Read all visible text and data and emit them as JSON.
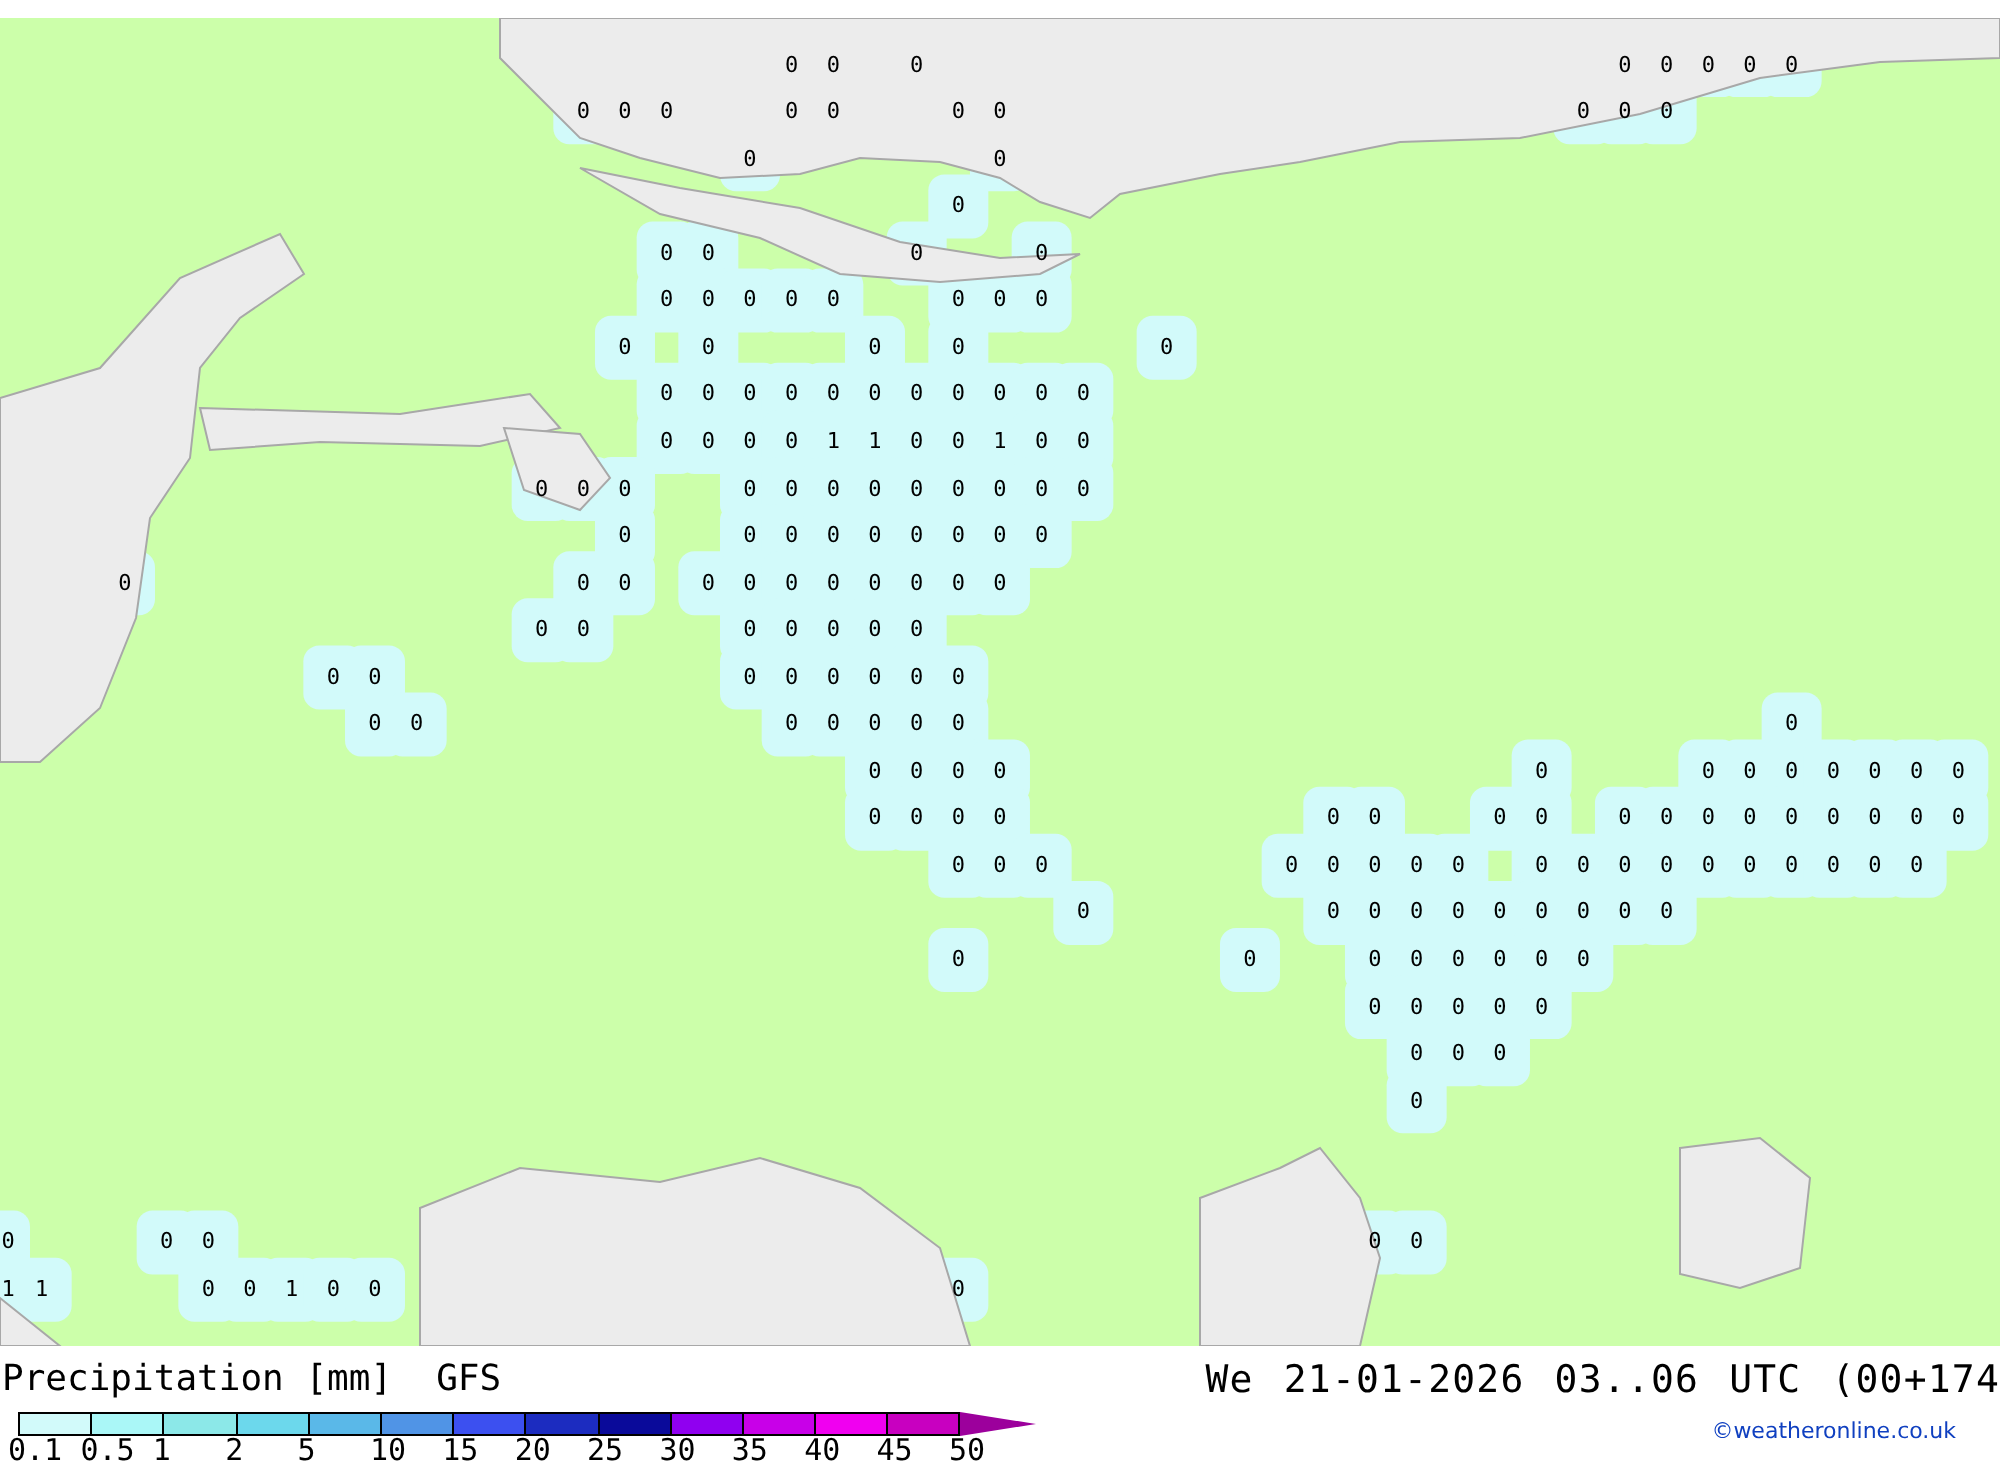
{
  "map": {
    "value_rows": [
      [
        "0",
        "0",
        "0",
        "0",
        "0",
        "0",
        "0",
        "0"
      ],
      [
        "0",
        "0",
        "0",
        "0",
        "0",
        "0",
        "0",
        "0",
        "0",
        "0"
      ],
      [
        "0",
        "0"
      ],
      [
        "0"
      ],
      [
        "0",
        "0",
        "0",
        "0"
      ],
      [
        "0",
        "0",
        "0",
        "0",
        "0",
        "0",
        "0",
        "0"
      ],
      [
        "0",
        "0",
        "0",
        "0",
        "0"
      ],
      [
        "0",
        "0",
        "0",
        "0",
        "0",
        "0",
        "0",
        "0",
        "0",
        "0",
        "0"
      ],
      [
        "0",
        "0",
        "0",
        "0",
        "1",
        "1",
        "0",
        "0",
        "1",
        "0",
        "0"
      ],
      [
        "0",
        "0",
        "0",
        "0",
        "0",
        "0",
        "0",
        "0",
        "0",
        "0",
        "0",
        "0"
      ],
      [
        "0",
        "0",
        "0",
        "0",
        "0",
        "0",
        "0",
        "0",
        "0"
      ],
      [
        "0",
        "0",
        "0",
        "0",
        "0",
        "0",
        "0",
        "0",
        "0",
        "0",
        "0"
      ],
      [
        "0",
        "0",
        "0",
        "0",
        "0",
        "0",
        "0"
      ],
      [
        "0",
        "0",
        "0",
        "0",
        "0",
        "0",
        "0",
        "0"
      ],
      [
        "0",
        "0",
        "0",
        "0",
        "0",
        "0",
        "0",
        "0"
      ],
      [
        "0",
        "0",
        "0",
        "0",
        "0",
        "0",
        "0",
        "0",
        "0",
        "0",
        "0",
        "0"
      ],
      [
        "0",
        "0",
        "0",
        "0",
        "0",
        "0",
        "0",
        "0",
        "0",
        "0",
        "0",
        "0",
        "0",
        "0",
        "0",
        "0",
        "0"
      ],
      [
        "0",
        "0",
        "0",
        "0",
        "0",
        "0",
        "0",
        "0",
        "0",
        "0",
        "0",
        "0",
        "0",
        "0",
        "0",
        "0",
        "0",
        "0"
      ],
      [
        "0",
        "0",
        "0",
        "0",
        "0",
        "0",
        "0",
        "0",
        "0",
        "0"
      ],
      [
        "0",
        "0",
        "0",
        "0",
        "0",
        "0",
        "0",
        "0"
      ],
      [
        "0",
        "0",
        "0",
        "0",
        "0"
      ],
      [
        "0",
        "0",
        "0"
      ],
      [
        "0"
      ],
      [
        "0",
        "0",
        "0",
        "0",
        "0"
      ],
      [
        "1",
        "1",
        "0",
        "0",
        "1",
        "0",
        "0",
        "0"
      ]
    ]
  },
  "legend": {
    "title": "Precipitation [mm]",
    "model": "GFS",
    "scale": [
      {
        "color": "#d2fafa"
      },
      {
        "color": "#aaf7f7"
      },
      {
        "color": "#8ce8e8"
      },
      {
        "color": "#6cd8ec"
      },
      {
        "color": "#5ab8e8"
      },
      {
        "color": "#5094e6"
      },
      {
        "color": "#3c50f0"
      },
      {
        "color": "#1c2cc0"
      },
      {
        "color": "#0a0a9a"
      },
      {
        "color": "#9000f0"
      },
      {
        "color": "#c800e8"
      },
      {
        "color": "#f000f0"
      },
      {
        "color": "#c800c0"
      },
      {
        "color": "#9c009c",
        "kind": "arrow"
      }
    ],
    "ticks": [
      "0.1",
      "0.5",
      "1",
      "2",
      "5",
      "10",
      "15",
      "20",
      "25",
      "30",
      "35",
      "40",
      "45",
      "50"
    ]
  },
  "valid_time": "We 21-01-2026 03..06 UTC (00+174",
  "credit": "©weatheronline.co.uk"
}
